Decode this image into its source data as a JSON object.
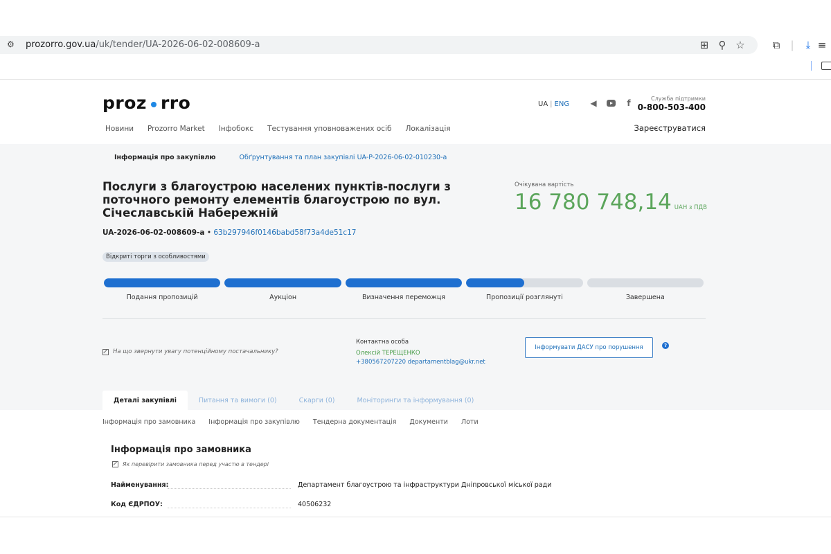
{
  "browser": {
    "url_host": "prozorro.gov.ua",
    "url_path": "/uk/tender/UA-2026-06-02-008609-a"
  },
  "header": {
    "logo_left": "proz",
    "logo_right": "rro",
    "nav": [
      "Новини",
      "Prozorro Market",
      "Інфобокс",
      "Тестування уповноважених осіб",
      "Локалізація"
    ],
    "lang_ua": "UA",
    "lang_eng": "ENG",
    "support_label": "Служба підтримки",
    "support_phone": "0-800-503-400",
    "register": "Зареєструватися"
  },
  "tender": {
    "tab_info": "Інформація про закупівлю",
    "tab_plan": "Обґрунтування та план закупівлі UA-P-2026-06-02-010230-a",
    "title": "Послуги з благоустрою населених пунктів-послуги з поточного ремонту елементів благоустрою по вул. Січеславській Набережній",
    "id": "UA-2026-06-02-008609-a",
    "hash": "63b297946f0146babd58f73a4de51c17",
    "badge": "Відкриті торги з особливостями",
    "value_label": "Очікувана вартість",
    "value_amount": "16 780 748,14",
    "value_currency": "UAH з ПДВ",
    "stages": [
      {
        "label": "Подання пропозицій",
        "progress": 1.0
      },
      {
        "label": "Аукціон",
        "progress": 1.0
      },
      {
        "label": "Визначення переможця",
        "progress": 1.0
      },
      {
        "label": "Пропозиції розглянуті",
        "progress": 0.5
      },
      {
        "label": "Завершена",
        "progress": 0.0
      }
    ],
    "attention": "На що звернути увагу потенційному постачальнику?",
    "contact_label": "Контактна особа",
    "contact_name": "Олексій ТЕРЕЩЕНКО",
    "contact_phone_email": "+380567207220 departamentblag@ukr.net",
    "dasu_button": "Інформувати ДАСУ про порушення",
    "help": "?",
    "bottom_tabs": [
      "Деталі закупівлі",
      "Питання та вимоги (0)",
      "Скарги (0)",
      "Моніторинги та інформування (0)"
    ]
  },
  "details": {
    "subnav": [
      "Інформація про замовника",
      "Інформація про закупівлю",
      "Тендерна документація",
      "Документи",
      "Лоти"
    ],
    "section_title": "Інформація про замовника",
    "check_link": "Як перевірити замовника перед участю в тендері",
    "rows": [
      {
        "key": "Найменування:",
        "value": "Департамент благоустрою та інфраструктури Дніпровської міської ради"
      },
      {
        "key": "Код ЄДРПОУ:",
        "value": "40506232"
      }
    ]
  }
}
